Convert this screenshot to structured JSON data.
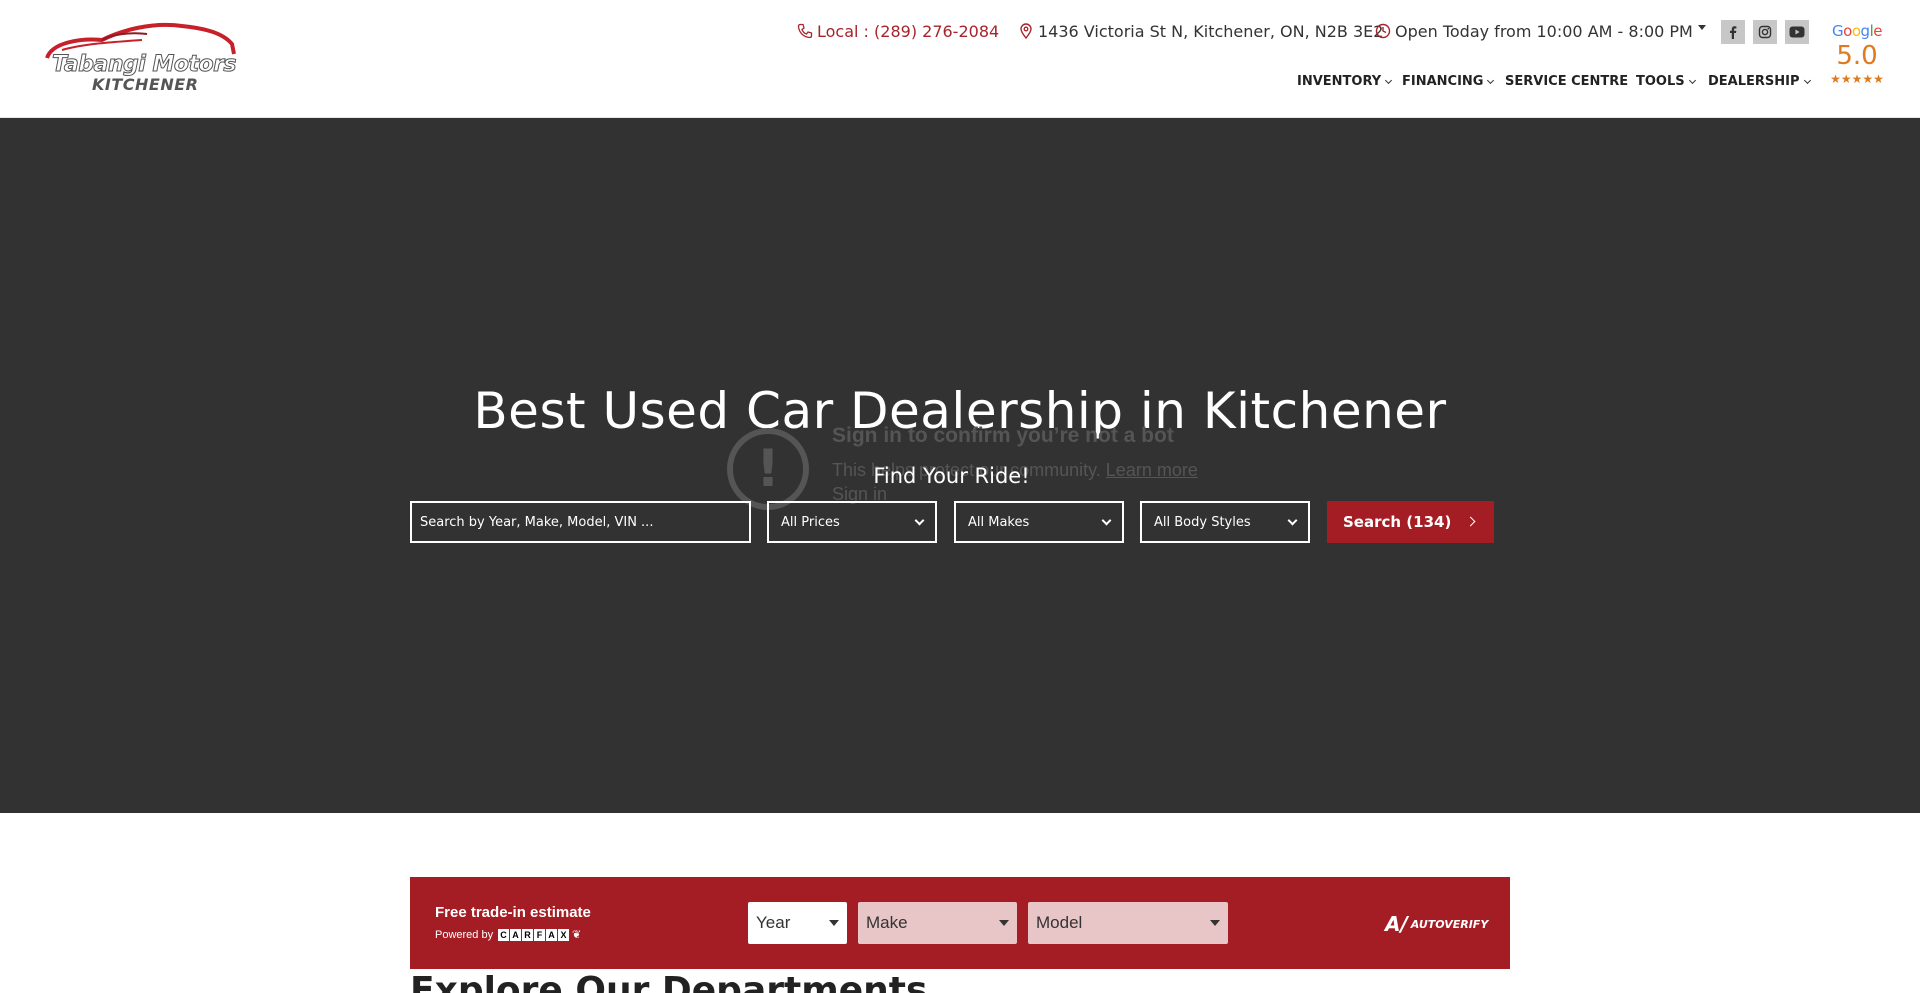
{
  "header": {
    "logo_line1": "Tabangi Motors",
    "logo_line2": "KITCHENER",
    "phone": "Local : (289) 276-2084",
    "address": "1436 Victoria St N, Kitchener, ON, N2B 3E2",
    "hours": "Open Today from 10:00 AM - 8:00 PM",
    "google_label": "Google",
    "google_rating": "5.0",
    "stars": "★★★★★",
    "nav": {
      "inventory": "INVENTORY",
      "financing": "FINANCING",
      "service": "SERVICE CENTRE",
      "tools": "TOOLS",
      "dealership": "DEALERSHIP"
    },
    "social_icons": [
      "facebook-icon",
      "instagram-icon",
      "youtube-icon"
    ]
  },
  "hero": {
    "title": "Best Used Car Dealership in Kitchener",
    "subtitle": "Find Your Ride!",
    "search_placeholder": "Search by Year, Make, Model, VIN ...",
    "price_select": "All Prices",
    "make_select": "All Makes",
    "body_select": "All Body Styles",
    "search_button": "Search (134)"
  },
  "bot_overlay": {
    "title": "Sign in to confirm you’re not a bot",
    "text": "This helps protect our community.",
    "learn_more": "Learn more",
    "sign_in": "Sign in"
  },
  "trade_in": {
    "title": "Free trade-in estimate",
    "powered_by": "Powered by",
    "carfax_letters": [
      "C",
      "A",
      "R",
      "F",
      "A",
      "X"
    ],
    "year_select": "Year",
    "make_select": "Make",
    "model_select": "Model",
    "brand": "AUTOVERIFY"
  },
  "section": {
    "explore_title": "Explore Our Departments"
  },
  "colors": {
    "brand_red": "#a51d24",
    "hero_bg": "#323232",
    "google_orange": "#e07a1f"
  }
}
